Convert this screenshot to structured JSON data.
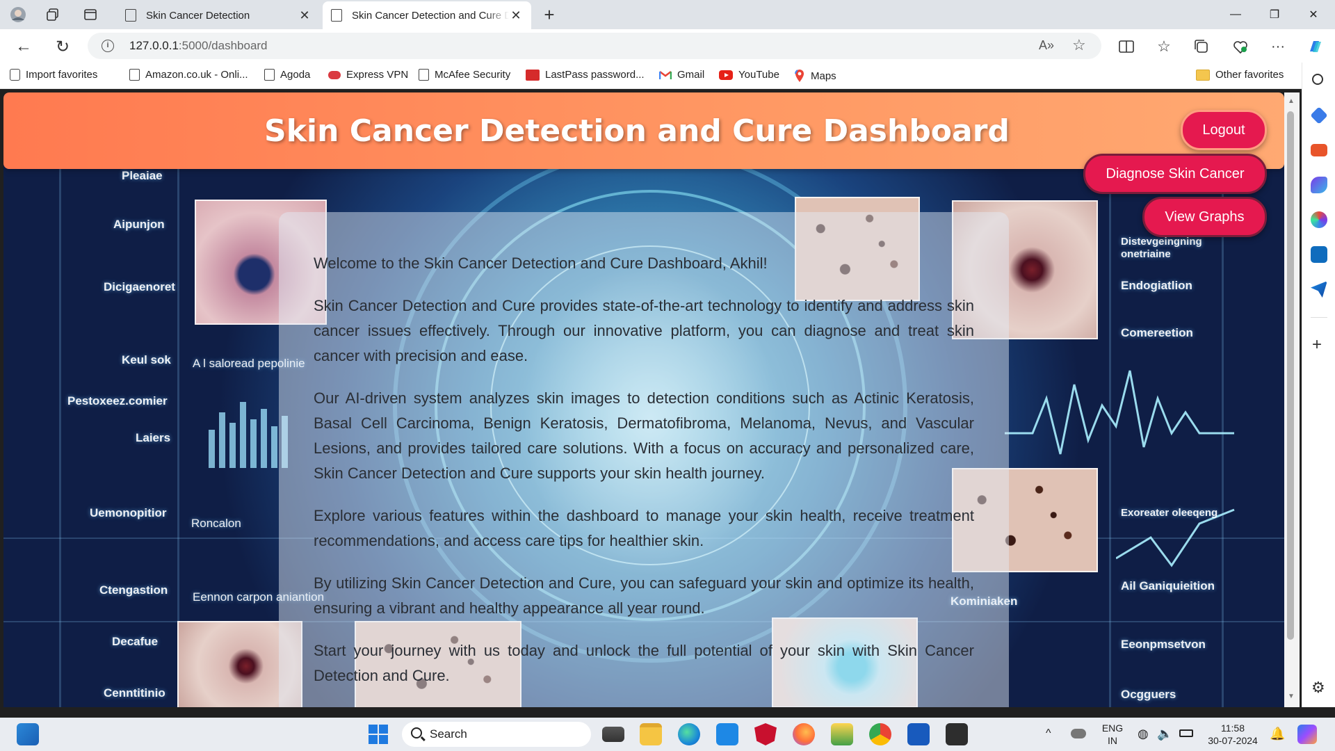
{
  "browser": {
    "tabs": [
      {
        "title": "Skin Cancer Detection",
        "active": false
      },
      {
        "title": "Skin Cancer Detection and Cure Dashboard",
        "active": true
      }
    ],
    "address": {
      "host": "127.0.0.1",
      "path": ":5000/dashboard"
    },
    "favorites": [
      {
        "label": "Import favorites",
        "icon": "import-icon"
      },
      {
        "label": "Amazon.co.uk - Onli...",
        "icon": "page-icon"
      },
      {
        "label": "Agoda",
        "icon": "page-icon"
      },
      {
        "label": "Express VPN",
        "icon": "expressvpn-icon"
      },
      {
        "label": "McAfee Security",
        "icon": "page-icon"
      },
      {
        "label": "LastPass password...",
        "icon": "lastpass-icon"
      },
      {
        "label": "Gmail",
        "icon": "gmail-icon"
      },
      {
        "label": "YouTube",
        "icon": "youtube-icon"
      },
      {
        "label": "Maps",
        "icon": "maps-icon"
      }
    ],
    "other_favorites": "Other favorites"
  },
  "page": {
    "title": "Skin Cancer Detection and Cure Dashboard",
    "buttons": {
      "logout": "Logout",
      "diagnose": "Diagnose Skin Cancer",
      "graphs": "View Graphs"
    },
    "paragraphs": [
      "Welcome to the Skin Cancer Detection and Cure Dashboard, Akhil!",
      "Skin Cancer Detection and Cure provides state-of-the-art technology to identify and address skin cancer issues effectively. Through our innovative platform, you can diagnose and treat skin cancer with precision and ease.",
      "Our AI-driven system analyzes skin images to detection conditions such as Actinic Keratosis, Basal Cell Carcinoma, Benign Keratosis, Dermatofibroma, Melanoma, Nevus, and Vascular Lesions, and provides tailored care solutions. With a focus on accuracy and personalized care, Skin Cancer Detection and Cure supports your skin health journey.",
      "Explore various features within the dashboard to manage your skin health, receive treatment recommendations, and access care tips for healthier skin.",
      "By utilizing Skin Cancer Detection and Cure, you can safeguard your skin and optimize its health, ensuring a vibrant and healthy appearance all year round.",
      "Start your journey with us today and unlock the full potential of your skin with Skin Cancer Detection and Cure."
    ],
    "background_labels_left": [
      "Pleaiae",
      "Aipunjon",
      "Dicigaenoret",
      "Keul sok",
      "Pestoxeez.comier",
      "Laiers",
      "Uemonopitior",
      "Ctengastion",
      "Decafue",
      "Cenntitinio"
    ],
    "background_labels_mid": [
      "A l saloread pepolinie",
      "Roncalon",
      "Eennon carpon aniantion"
    ],
    "background_labels_right": [
      "Distevgeingning onetriaine",
      "Endogiatlion",
      "Comereetion",
      "Exoreater oleeqeng",
      "Ail Ganiquieition",
      "Eeonpmsetvon",
      "Ocgguers",
      "Kominiaken"
    ]
  },
  "taskbar": {
    "search_placeholder": "Search",
    "lang_top": "ENG",
    "lang_bottom": "IN",
    "time": "11:58",
    "date": "30-07-2024"
  },
  "colors": {
    "banner_start": "#ff7a50",
    "banner_end": "#ffa972",
    "button": "#e5194f"
  }
}
